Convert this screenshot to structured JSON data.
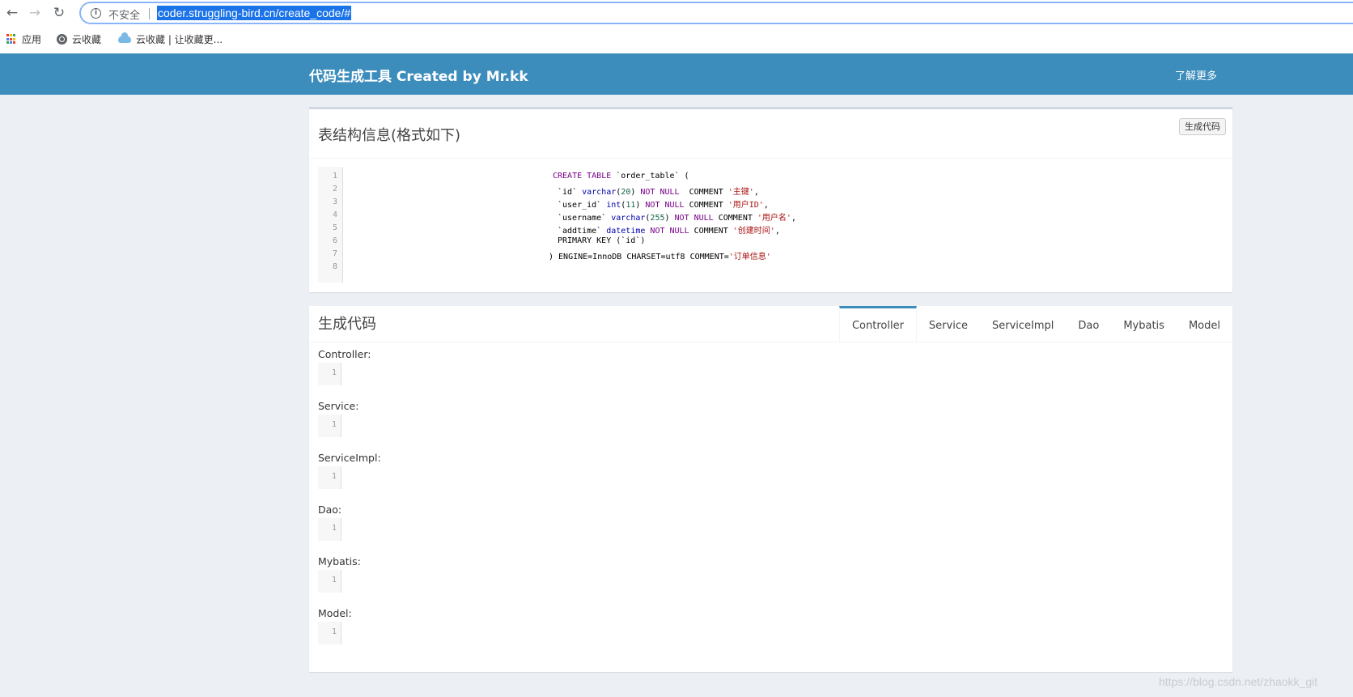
{
  "browser": {
    "security_label": "不安全",
    "url": "coder.struggling-bird.cn/create_code/#",
    "bookmarks": [
      {
        "label": "应用",
        "icon": "apps-grid-icon"
      },
      {
        "label": "云收藏",
        "icon": "globe-icon"
      },
      {
        "label": "云收藏 | 让收藏更...",
        "icon": "cloud-icon"
      }
    ],
    "apps_icon_colors": [
      "#ea4335",
      "#fbbc05",
      "#34a853",
      "#4285f4",
      "#ea4335",
      "#fbbc05",
      "#34a853",
      "#4285f4",
      "#ea4335"
    ]
  },
  "header": {
    "title": "代码生成工具 Created by Mr.kk",
    "learn_more": "了解更多",
    "bg_color": "#3c8dbc"
  },
  "table_box": {
    "title": "表结构信息(格式如下)",
    "generate_button": "生成代码",
    "line_numbers": [
      "1",
      "2",
      "3",
      "4",
      "5",
      "6",
      "7",
      "8"
    ],
    "code": [
      [
        [
          "kw",
          "CREATE TABLE"
        ],
        [
          "pl",
          " `order_table` ("
        ]
      ],
      [
        [
          "pl",
          "`id` "
        ],
        [
          "ty",
          "varchar"
        ],
        [
          "pl",
          "("
        ],
        [
          "nu",
          "20"
        ],
        [
          "pl",
          ") "
        ],
        [
          "kw",
          "NOT NULL"
        ],
        [
          "pl",
          "  COMMENT "
        ],
        [
          "st",
          "'主键'"
        ],
        [
          "pl",
          ","
        ]
      ],
      [
        [
          "pl",
          "`user_id` "
        ],
        [
          "ty",
          "int"
        ],
        [
          "pl",
          "("
        ],
        [
          "nu",
          "11"
        ],
        [
          "pl",
          ") "
        ],
        [
          "kw",
          "NOT NULL"
        ],
        [
          "pl",
          " COMMENT "
        ],
        [
          "st",
          "'用户ID'"
        ],
        [
          "pl",
          ","
        ]
      ],
      [
        [
          "pl",
          "`username` "
        ],
        [
          "ty",
          "varchar"
        ],
        [
          "pl",
          "("
        ],
        [
          "nu",
          "255"
        ],
        [
          "pl",
          ") "
        ],
        [
          "kw",
          "NOT NULL"
        ],
        [
          "pl",
          " COMMENT "
        ],
        [
          "st",
          "'用户名'"
        ],
        [
          "pl",
          ","
        ]
      ],
      [
        [
          "pl",
          "`addtime` "
        ],
        [
          "ty",
          "datetime"
        ],
        [
          "pl",
          " "
        ],
        [
          "kw",
          "NOT NULL"
        ],
        [
          "pl",
          " COMMENT "
        ],
        [
          "st",
          "'创建时间'"
        ],
        [
          "pl",
          ","
        ]
      ],
      [
        [
          "pl",
          "PRIMARY KEY (`id`)"
        ]
      ],
      [
        [
          "pl",
          ") ENGINE=InnoDB CHARSET=utf8 COMMENT="
        ],
        [
          "st",
          "'订单信息'"
        ]
      ],
      []
    ]
  },
  "code_box": {
    "title": "生成代码",
    "tabs": [
      "Controller",
      "Service",
      "ServiceImpl",
      "Dao",
      "Mybatis",
      "Model"
    ],
    "active_tab": "Controller",
    "sections": [
      {
        "label": "Controller:",
        "line": "1"
      },
      {
        "label": "Service:",
        "line": "1"
      },
      {
        "label": "ServiceImpl:",
        "line": "1"
      },
      {
        "label": "Dao:",
        "line": "1"
      },
      {
        "label": "Mybatis:",
        "line": "1"
      },
      {
        "label": "Model:",
        "line": "1"
      }
    ]
  },
  "watermark": "https://blog.csdn.net/zhaokk_git"
}
